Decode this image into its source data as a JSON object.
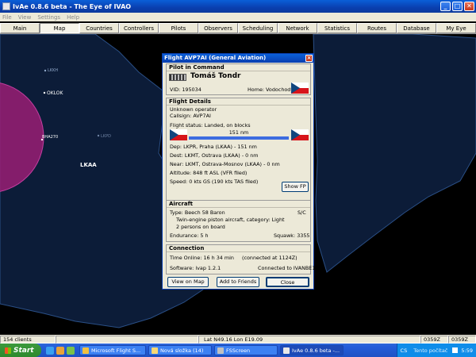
{
  "window": {
    "title": "IvAe 0.8.6 beta - The Eye of IVAO"
  },
  "menu": [
    "File",
    "View",
    "Settings",
    "Help"
  ],
  "tabs": [
    "Main",
    "Map",
    "Countries",
    "Controllers",
    "Pilots",
    "Observers",
    "Scheduling",
    "Network",
    "Statistics",
    "Routes",
    "Database",
    "My Eye"
  ],
  "active_tab": "Map",
  "map": {
    "labels": {
      "lkkh": "LKKH",
      "oklok": "OKLOK",
      "bha270": "BHA270",
      "lkpd": "LKPD",
      "lkaa": "LKAA"
    },
    "colors": {
      "fir_fill": "#0c1c38",
      "fir_border": "#2a4f86",
      "circle": "#9a1d74"
    }
  },
  "dialog": {
    "title": "Flight AVP7AI (General Aviation)",
    "pilot": {
      "header": "Pilot in Command",
      "name": "Tomáš Tondr",
      "vid": "VID: 195034",
      "home": "Home: Vodochody"
    },
    "flight": {
      "header": "Flight Details",
      "operator": "Unknown operator",
      "callsign": "Callsign: AVP7AI",
      "status": "Flight status: Landed, on blocks",
      "distance": "151 nm",
      "progress": 1.0,
      "dep": "Dep: LKPR, Praha (LKAA) - 151 nm",
      "dest": "Dest: LKMT, Ostrava (LKAA) - 0 nm",
      "near": "Near: LKMT, Ostrava-Mosnov (LKAA) - 0 nm",
      "altitude": "Altitude: 848 ft ASL (VFR filed)",
      "speed": "Speed: 0 kts GS (190 kts TAS filed)",
      "show_fp": "Show FP"
    },
    "aircraft": {
      "header": "Aircraft",
      "type": "Type: Beech 58 Baron",
      "class": "S/C",
      "desc": "Twin-engine piston aircraft, category: Light",
      "persons": "2 persons on board",
      "endurance": "Endurance: 5 h",
      "squawk": "Squawk: 3355"
    },
    "connection": {
      "header": "Connection",
      "time": "Time Online: 16 h 34 min",
      "connected_at": "(connected at 1124Z)",
      "software": "Software: ivap 1.2.1",
      "server": "Connected to IVANBE1"
    },
    "buttons": {
      "view_on_map": "View on Map",
      "add_friends": "Add to Friends",
      "close": "Close"
    }
  },
  "statusbar": {
    "clients": "154 clients",
    "coords": "Lat N49.16 Lon E19.09",
    "time1": "0359Z",
    "time2": "0359Z"
  },
  "taskbar": {
    "start": "Start",
    "items": [
      "Microsoft Flight S...",
      "Nová složka (14)",
      "FSScreen",
      "IvAe 0.8.6 beta -..."
    ],
    "active_index": 3,
    "lang": "CS",
    "search": "Tento počítač",
    "clock": "5:59"
  }
}
